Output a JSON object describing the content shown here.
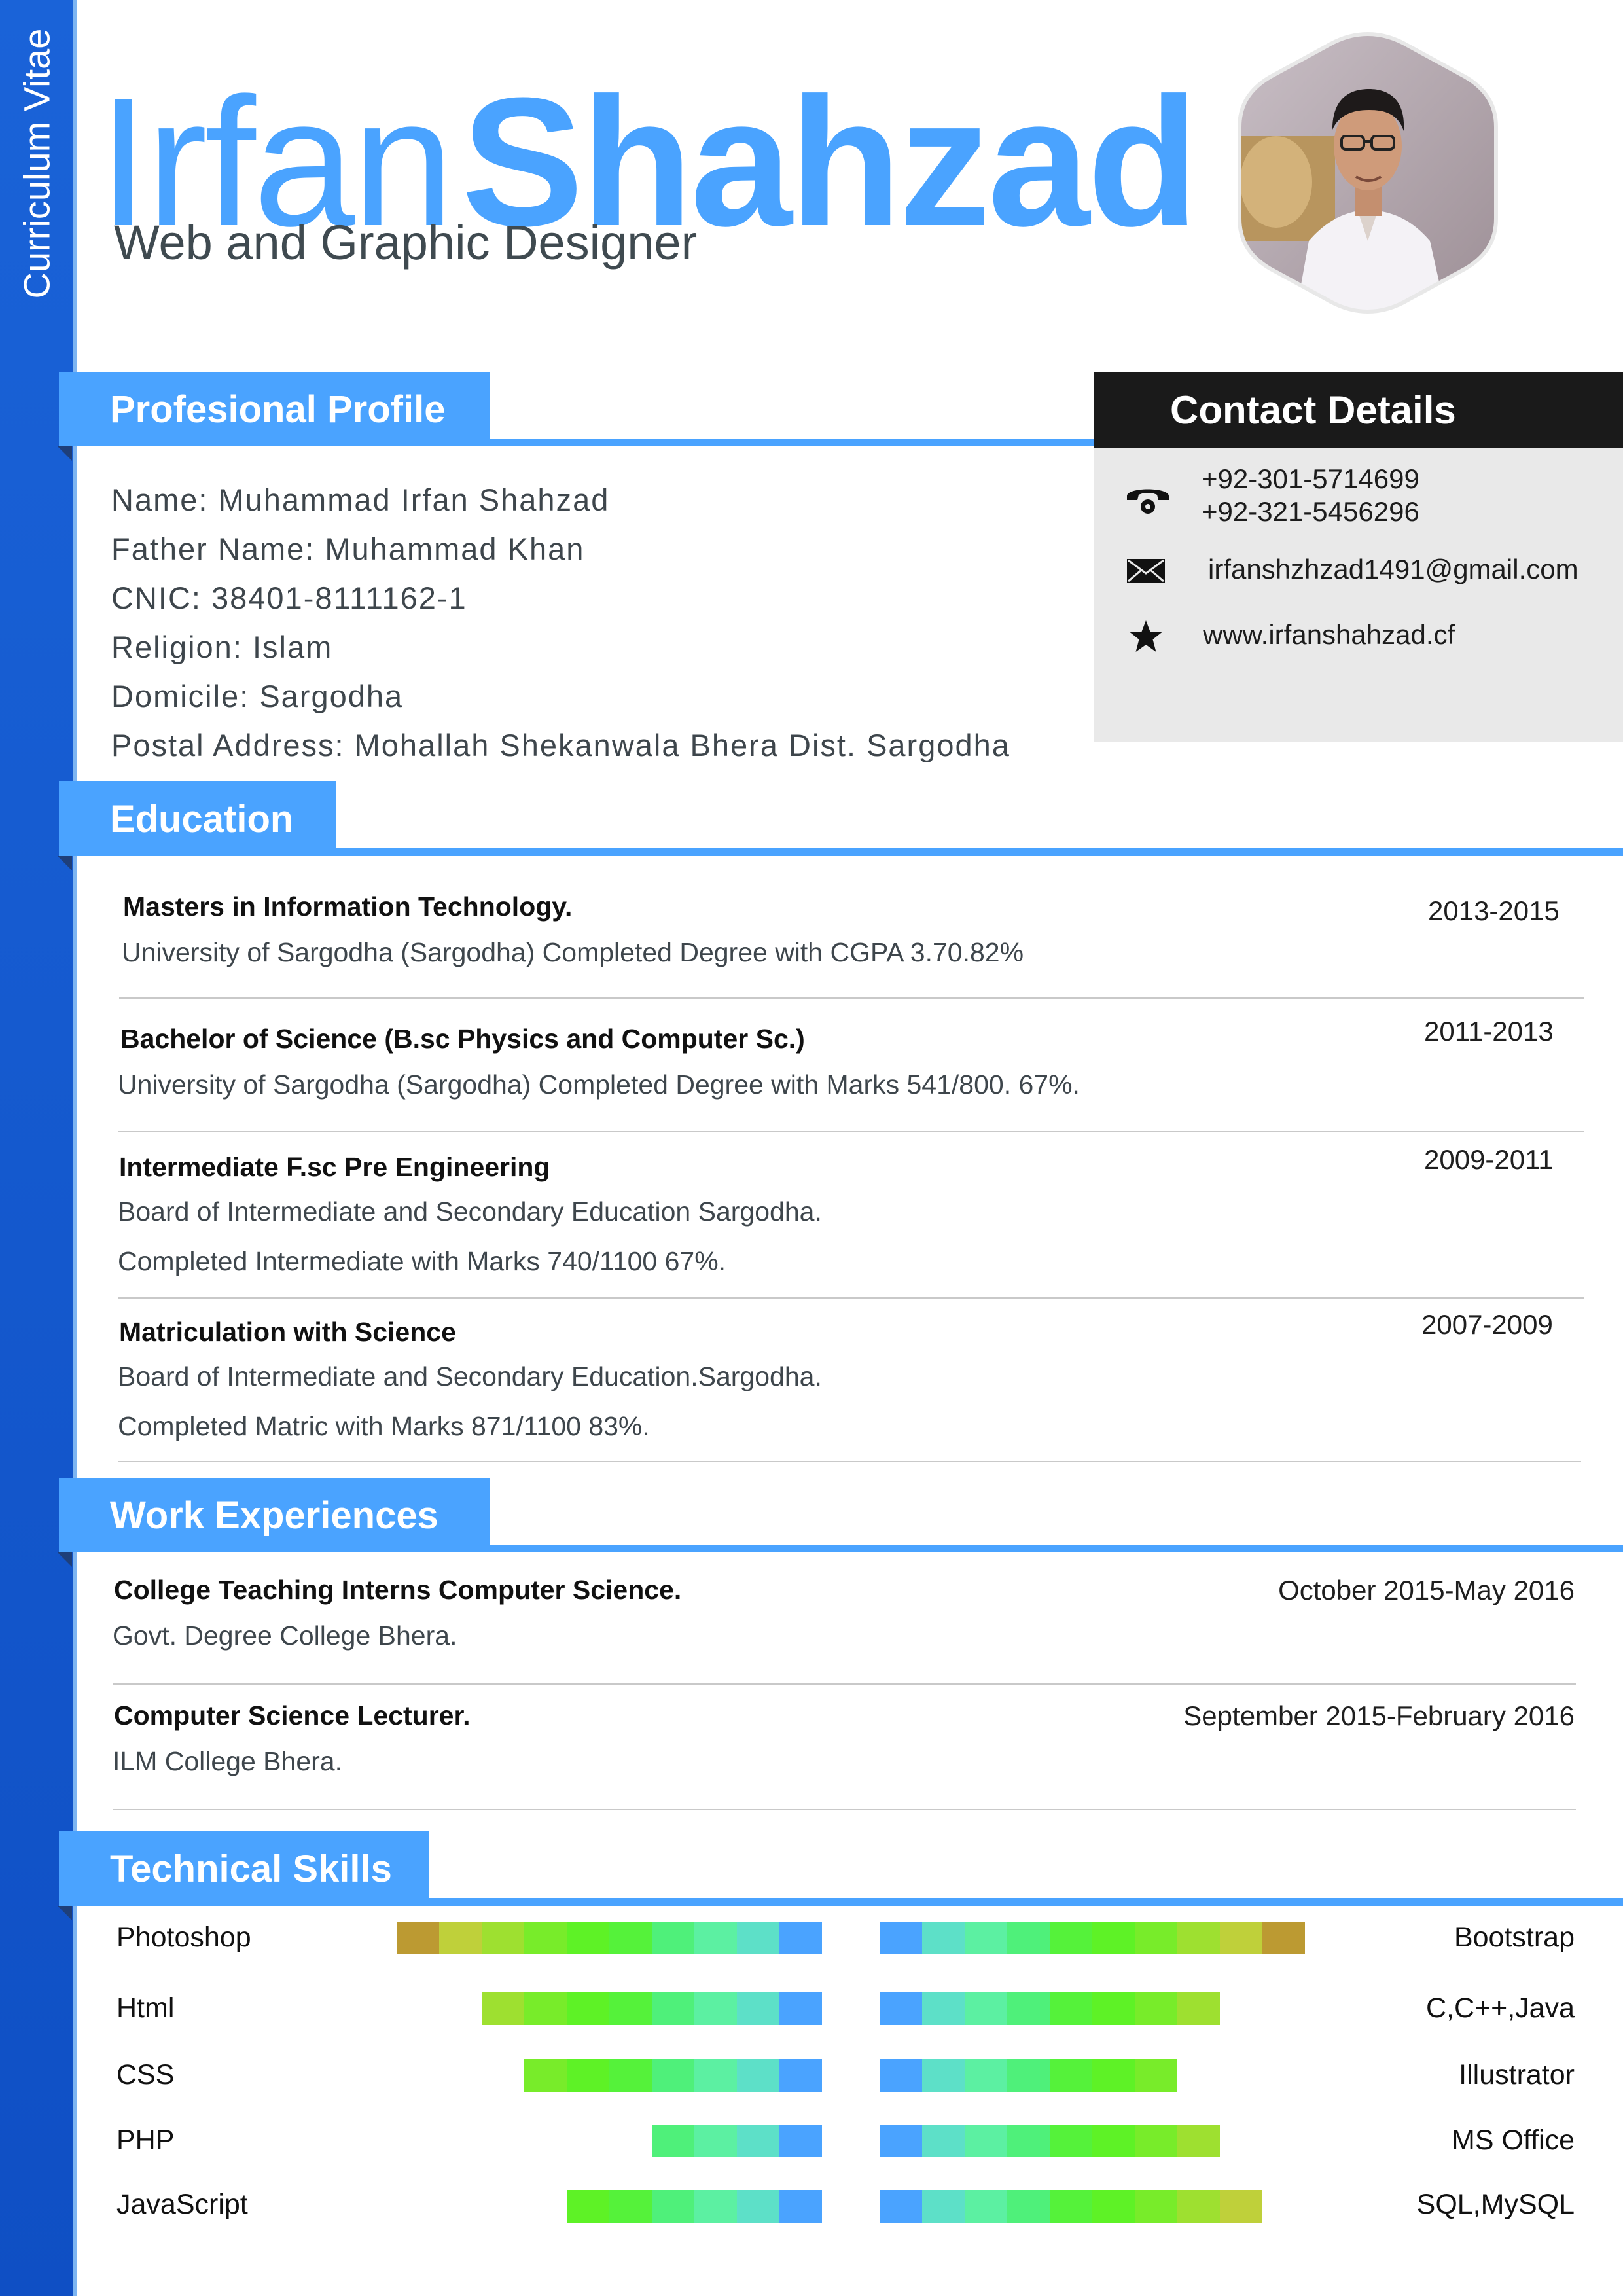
{
  "sidebar": {
    "label": "Curriculum Vitae"
  },
  "header": {
    "first_name": "Irfan",
    "last_name": "Shahzad",
    "title": "Web and Graphic Designer"
  },
  "colors": {
    "accent": "#4aa3ff",
    "sidebar": "#1a63d8",
    "dark": "#1a1a1a",
    "panel": "#e9e9e9"
  },
  "profile": {
    "heading": "Profesional Profile",
    "lines": [
      "Name: Muhammad Irfan Shahzad",
      "Father Name: Muhammad Khan",
      "CNIC: 38401-8111162-1",
      "Religion: Islam",
      "Domicile: Sargodha",
      "Postal Address: Mohallah Shekanwala Bhera Dist. Sargodha"
    ]
  },
  "contact": {
    "heading": "Contact Details",
    "phone_icon": "phone-icon",
    "phones": [
      "+92-301-5714699",
      "+92-321-5456296"
    ],
    "email_icon": "envelope-icon",
    "email": "irfanshzhzad1491@gmail.com",
    "web_icon": "star-icon",
    "website": "www.irfanshahzad.cf"
  },
  "education": {
    "heading": "Education",
    "items": [
      {
        "title": "Masters in Information Technology.",
        "years": "2013-2015",
        "lines": [
          "University of Sargodha (Sargodha) Completed Degree with CGPA 3.70.82%"
        ]
      },
      {
        "title": "Bachelor of Science (B.sc Physics and Computer Sc.)",
        "years": "2011-2013",
        "lines": [
          "University of Sargodha (Sargodha)  Completed Degree with Marks 541/800. 67%."
        ]
      },
      {
        "title": "Intermediate F.sc Pre Engineering",
        "years": "2009-2011",
        "lines": [
          "Board of Intermediate and Secondary Education Sargodha.",
          "Completed Intermediate with Marks 740/1100 67%."
        ]
      },
      {
        "title": "Matriculation with Science",
        "years": "2007-2009",
        "lines": [
          "Board of Intermediate and Secondary Education.Sargodha.",
          "Completed Matric with Marks 871/1100   83%."
        ]
      }
    ]
  },
  "work": {
    "heading": "Work Experiences",
    "items": [
      {
        "title": "College Teaching Interns Computer Science.",
        "dates": "October 2015-May 2016",
        "place": "Govt. Degree College Bhera."
      },
      {
        "title": "Computer Science Lecturer.",
        "dates": "September 2015-February 2016",
        "place": "ILM College Bhera."
      }
    ]
  },
  "skills": {
    "heading": "Technical Skills",
    "left": [
      {
        "name": "Photoshop",
        "level": 1.0
      },
      {
        "name": "Html",
        "level": 0.8
      },
      {
        "name": "CSS",
        "level": 0.7
      },
      {
        "name": "PHP",
        "level": 0.4
      },
      {
        "name": "JavaScript",
        "level": 0.6
      }
    ],
    "right": [
      {
        "name": "Bootstrap",
        "level": 1.0
      },
      {
        "name": "C,C++,Java",
        "level": 0.8
      },
      {
        "name": "Illustrator",
        "level": 0.7
      },
      {
        "name": "MS Office",
        "level": 0.8
      },
      {
        "name": "SQL,MySQL",
        "level": 0.9
      }
    ]
  }
}
